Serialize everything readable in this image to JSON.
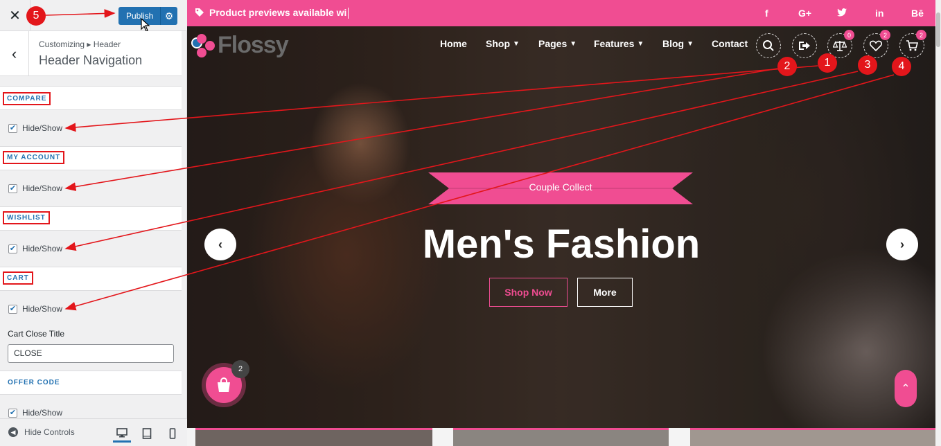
{
  "customizer": {
    "close_icon": "close-icon",
    "publish_label": "Publish",
    "breadcrumb": "Customizing ▸ Header",
    "section_title": "Header Navigation",
    "groups": [
      {
        "title": "COMPARE",
        "checkbox_label": "Hide/Show",
        "checked": true
      },
      {
        "title": "MY ACCOUNT",
        "checkbox_label": "Hide/Show",
        "checked": true
      },
      {
        "title": "WISHLIST",
        "checkbox_label": "Hide/Show",
        "checked": true
      },
      {
        "title": "CART",
        "checkbox_label": "Hide/Show",
        "checked": true
      }
    ],
    "cart_close_title_label": "Cart Close Title",
    "cart_close_title_value": "CLOSE",
    "offer_code": {
      "title": "OFFER CODE",
      "checkbox_label": "Hide/Show",
      "checked": true
    },
    "hide_controls_label": "Hide Controls"
  },
  "preview": {
    "topbar_message": "Product previews available wi",
    "social": [
      "f",
      "G+",
      "twitter",
      "in",
      "Bē"
    ],
    "logo_text": "Flossy",
    "nav": [
      {
        "label": "Home",
        "dropdown": false
      },
      {
        "label": "Shop",
        "dropdown": true
      },
      {
        "label": "Pages",
        "dropdown": true
      },
      {
        "label": "Features",
        "dropdown": true
      },
      {
        "label": "Blog",
        "dropdown": true
      },
      {
        "label": "Contact",
        "dropdown": false
      }
    ],
    "header_icons": [
      {
        "name": "search-icon",
        "badge": ""
      },
      {
        "name": "my-account-icon",
        "badge": ""
      },
      {
        "name": "compare-icon",
        "badge": "0"
      },
      {
        "name": "wishlist-icon",
        "badge": "2"
      },
      {
        "name": "cart-icon",
        "badge": "2"
      }
    ],
    "ribbon_text": "Couple Collect",
    "hero_title": "Men's Fashion",
    "shop_now_label": "Shop Now",
    "more_label": "More",
    "floating_cart_count": "2"
  },
  "annotations": [
    "5",
    "2",
    "1",
    "3",
    "4"
  ],
  "colors": {
    "accent": "#f04d92",
    "wp_blue": "#2271b1",
    "annotation_red": "#e3161b"
  }
}
